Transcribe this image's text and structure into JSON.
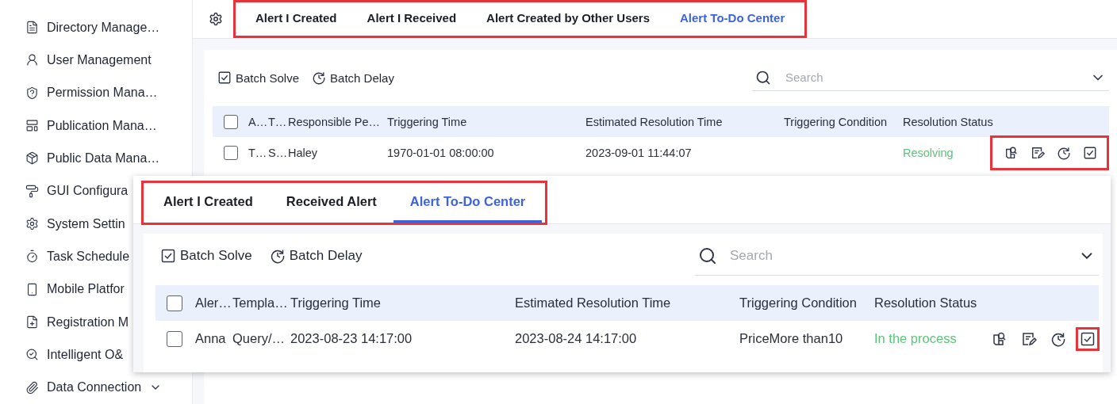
{
  "sidebar": {
    "items": [
      {
        "label": "Directory Manage…",
        "kind": "page"
      },
      {
        "label": "User Management",
        "kind": "page"
      },
      {
        "label": "Permission Mana…",
        "kind": "page"
      },
      {
        "label": "Publication Mana…",
        "kind": "page"
      },
      {
        "label": "Public Data Mana…",
        "kind": "page"
      },
      {
        "label": "GUI Configura",
        "kind": "page"
      },
      {
        "label": "System Settin",
        "kind": "page"
      },
      {
        "label": "Task Schedule",
        "kind": "page"
      },
      {
        "label": "Mobile Platfor",
        "kind": "page"
      },
      {
        "label": "Registration M",
        "kind": "page"
      },
      {
        "label": "Intelligent O&",
        "kind": "page"
      },
      {
        "label": "Data Connection",
        "kind": "group"
      }
    ]
  },
  "panels": [
    {
      "tabs_framed": true,
      "tabs": [
        {
          "label": "Alert I Created",
          "selected": false
        },
        {
          "label": "Alert I Received",
          "selected": false
        },
        {
          "label": "Alert Created by Other Users",
          "selected": false
        },
        {
          "label": "Alert To-Do Center",
          "selected": true
        }
      ],
      "toolbar": [
        {
          "label": "Batch Solve",
          "kind": "solve"
        },
        {
          "label": "Batch Delay",
          "kind": "delay"
        }
      ],
      "search": {
        "placeholder": "Search"
      },
      "table": {
        "header_checked": false,
        "columns": [
          "A…",
          "T…",
          "Responsible Pe…",
          "Triggering Time",
          "Estimated Resolution Time",
          "Triggering Condition",
          "Resolution Status"
        ],
        "rows": [
          {
            "checked": false,
            "cells": [
              "T…",
              "S…",
              "Haley",
              "1970-01-01 08:00:00",
              "2023-09-01 11:44:07",
              null
            ],
            "status": "Resolving",
            "actions_framed": true,
            "actions": [
              {
                "kind": "view",
                "framed": false
              },
              {
                "kind": "edit",
                "framed": false
              },
              {
                "kind": "delay",
                "framed": false
              },
              {
                "kind": "solve",
                "framed": false
              }
            ]
          }
        ]
      }
    },
    {
      "tabs_framed": true,
      "tabs": [
        {
          "label": "Alert I Created",
          "selected": false
        },
        {
          "label": "Received Alert",
          "selected": false
        },
        {
          "label": "Alert To-Do Center",
          "selected": true
        }
      ],
      "toolbar": [
        {
          "label": "Batch Solve",
          "kind": "solve"
        },
        {
          "label": "Batch Delay",
          "kind": "delay"
        }
      ],
      "search": {
        "placeholder": "Search"
      },
      "table": {
        "header_checked": false,
        "columns": [
          "Aler…",
          "Templa…",
          "Triggering Time",
          "Estimated Resolution Time",
          "Triggering Condition",
          "Resolution Status"
        ],
        "rows": [
          {
            "checked": false,
            "cells": [
              "Anna",
              "Query/…",
              "2023-08-23 14:17:00",
              "2023-08-24 14:17:00",
              "PriceMore than10"
            ],
            "status": "In the process",
            "actions_framed": false,
            "actions": [
              {
                "kind": "view",
                "framed": false
              },
              {
                "kind": "edit",
                "framed": false
              },
              {
                "kind": "delay",
                "framed": false
              },
              {
                "kind": "solve",
                "framed": true
              }
            ]
          }
        ]
      }
    }
  ]
}
